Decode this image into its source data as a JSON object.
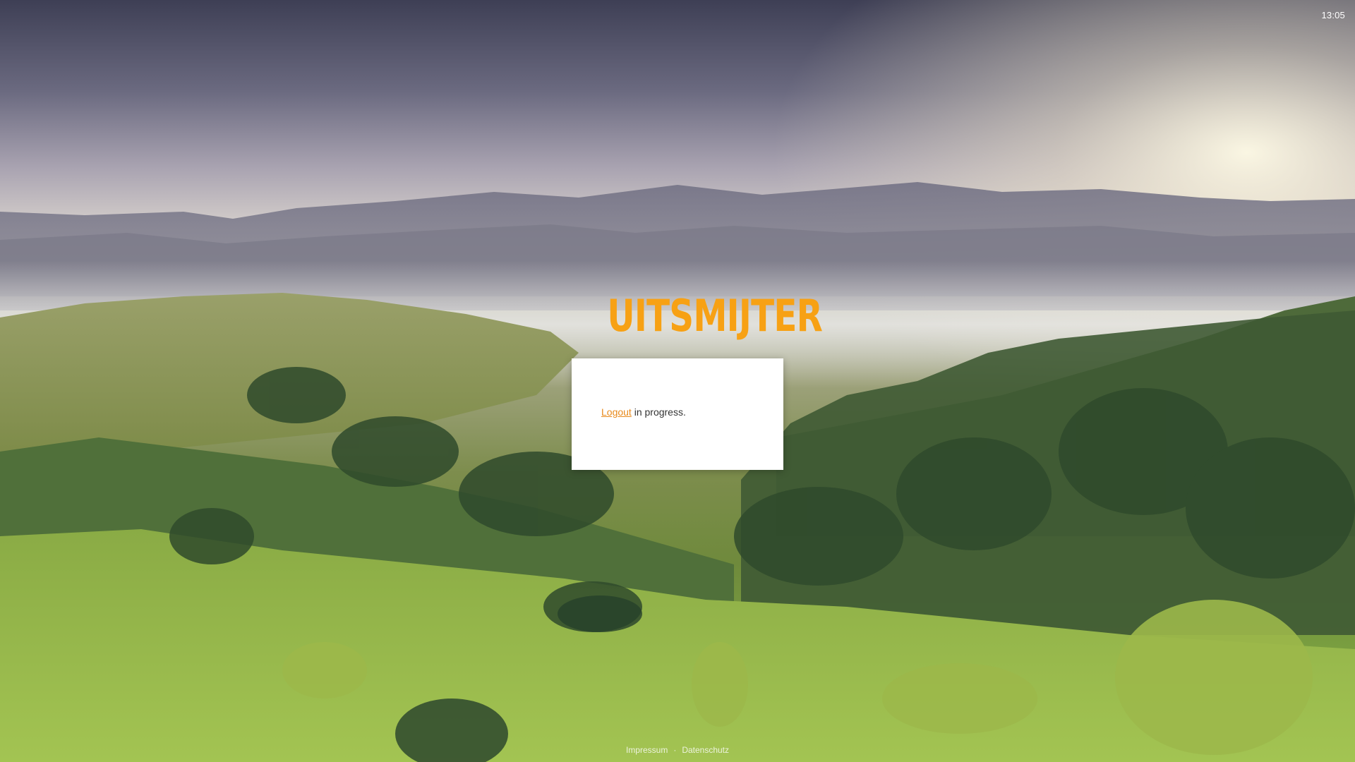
{
  "clock": {
    "time": "13:05"
  },
  "logo": {
    "text": "UITSMIJTER"
  },
  "card": {
    "link_label": "Logout",
    "message_suffix": " in progress."
  },
  "footer": {
    "impressum": "Impressum",
    "separator": "·",
    "datenschutz": "Datenschutz"
  },
  "colors": {
    "accent": "#f7a114",
    "link": "#e8891a",
    "card_bg": "#ffffff"
  },
  "background": {
    "description_icon": "landscape-photo"
  }
}
